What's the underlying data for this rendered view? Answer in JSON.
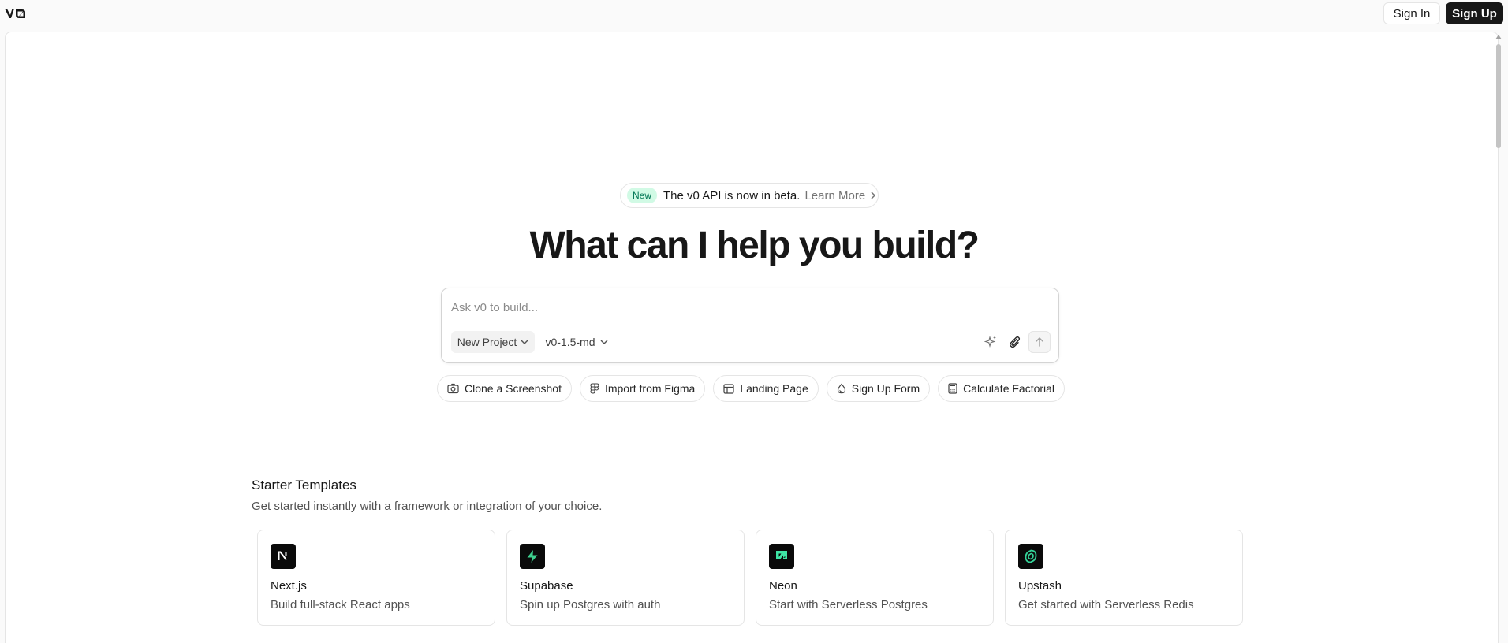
{
  "header": {
    "logo": "v0",
    "sign_in_label": "Sign In",
    "sign_up_label": "Sign Up"
  },
  "announcement": {
    "badge": "New",
    "text": "The v0 API is now in beta.",
    "link": "Learn More"
  },
  "headline": "What can I help you build?",
  "prompt": {
    "placeholder": "Ask v0 to build...",
    "value": "",
    "project_label": "New Project",
    "model_label": "v0-1.5-md"
  },
  "suggestions": [
    {
      "label": "Clone a Screenshot",
      "icon": "camera-icon"
    },
    {
      "label": "Import from Figma",
      "icon": "figma-icon"
    },
    {
      "label": "Landing Page",
      "icon": "layout-icon"
    },
    {
      "label": "Sign Up Form",
      "icon": "drop-icon"
    },
    {
      "label": "Calculate Factorial",
      "icon": "calculator-icon"
    }
  ],
  "starter_templates": {
    "title": "Starter Templates",
    "subtitle": "Get started instantly with a framework or integration of your choice.",
    "cards": [
      {
        "title": "Next.js",
        "description": "Build full-stack React apps",
        "icon": "nextjs-icon"
      },
      {
        "title": "Supabase",
        "description": "Spin up Postgres with auth",
        "icon": "supabase-icon"
      },
      {
        "title": "Neon",
        "description": "Start with Serverless Postgres",
        "icon": "neon-icon"
      },
      {
        "title": "Upstash",
        "description": "Get started with Serverless Redis",
        "icon": "upstash-icon"
      }
    ]
  },
  "colors": {
    "accent_dark": "#171717",
    "badge_bg": "#d1fae5",
    "badge_text": "#047857",
    "supabase_green": "#3ecf8e",
    "neon_green": "#3ee5a5",
    "upstash_green": "#34d399"
  }
}
